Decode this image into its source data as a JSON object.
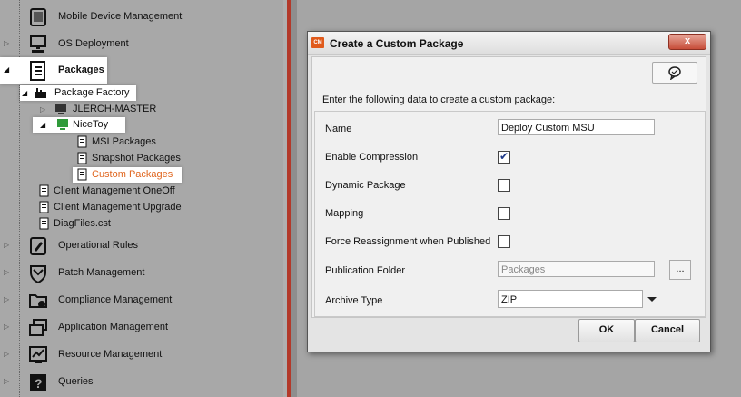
{
  "nav": {
    "items": [
      {
        "label": "Mobile Device Management",
        "icon": "mobile-device-icon"
      },
      {
        "label": "OS Deployment",
        "icon": "os-deployment-icon"
      },
      {
        "label": "Packages",
        "icon": "packages-icon"
      },
      {
        "label": "Operational Rules",
        "icon": "operational-rules-icon"
      },
      {
        "label": "Patch Management",
        "icon": "patch-shield-icon"
      },
      {
        "label": "Compliance Management",
        "icon": "compliance-folder-icon"
      },
      {
        "label": "Application Management",
        "icon": "application-windows-icon"
      },
      {
        "label": "Resource Management",
        "icon": "resource-chart-icon"
      },
      {
        "label": "Queries",
        "icon": "queries-icon"
      }
    ],
    "tree": {
      "package_factory": "Package Factory",
      "jlerch_master": "JLERCH-MASTER",
      "nicetoy": "NiceToy",
      "msi_packages": "MSI Packages",
      "snapshot_packages": "Snapshot Packages",
      "custom_packages": "Custom Packages",
      "client_mgmt_oneoff": "Client Management OneOff",
      "client_mgmt_upgrade": "Client Management Upgrade",
      "diagfiles": "DiagFiles.cst"
    }
  },
  "dialog": {
    "title": "Create a Custom Package",
    "title_icon_text": "CM",
    "close_label": "x",
    "instructions": "Enter the following data to create a custom package:",
    "fields": {
      "name_label": "Name",
      "name_value": "Deploy Custom MSU",
      "compression_label": "Enable Compression",
      "compression_checked": true,
      "dynamic_label": "Dynamic Package",
      "dynamic_checked": false,
      "mapping_label": "Mapping",
      "mapping_checked": false,
      "force_label": "Force Reassignment when Published",
      "force_checked": false,
      "publication_label": "Publication Folder",
      "publication_placeholder": "Packages",
      "browse_label": "...",
      "archive_label": "Archive Type",
      "archive_value": "ZIP"
    },
    "ok_label": "OK",
    "cancel_label": "Cancel"
  },
  "colors": {
    "accent_orange": "#e0651d",
    "close_red": "#c74d39",
    "divider_red": "#b3392a"
  }
}
